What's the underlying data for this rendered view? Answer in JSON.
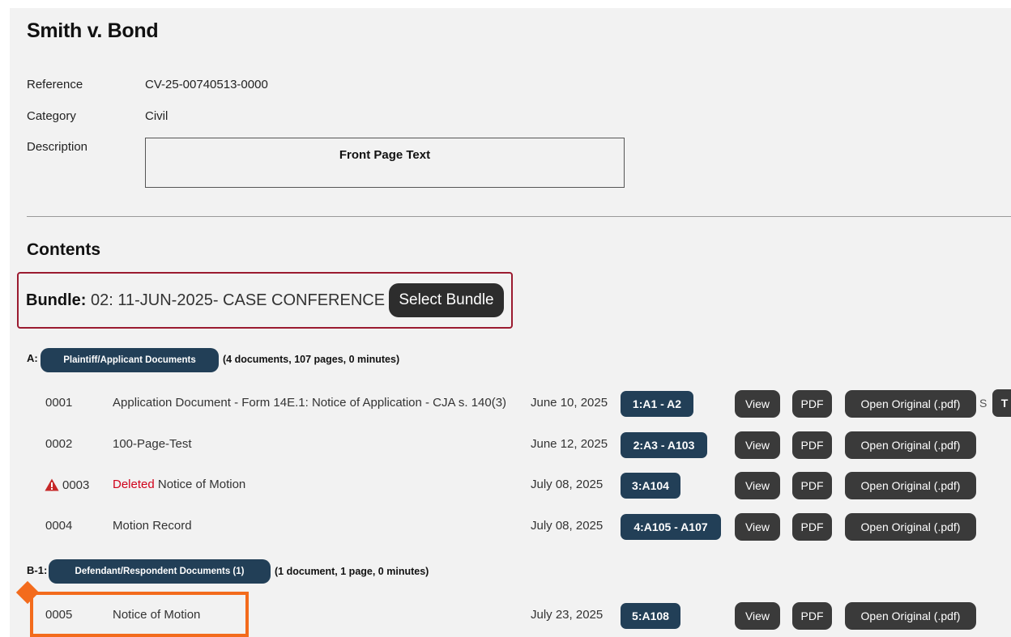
{
  "case": {
    "title": "Smith v. Bond",
    "reference_label": "Reference",
    "reference_value": "CV-25-00740513-0000",
    "category_label": "Category",
    "category_value": "Civil",
    "description_label": "Description",
    "description_value": "Front Page Text"
  },
  "contents": {
    "heading": "Contents",
    "bundle_label": "Bundle:",
    "bundle_value": "02: 11-JUN-2025- CASE CONFERENCE",
    "select_bundle": "Select Bundle"
  },
  "sections": [
    {
      "prefix": "A:",
      "name": "Plaintiff/Applicant Documents",
      "summary": "(4 documents, 107 pages, 0 minutes)"
    },
    {
      "prefix": "B-1:",
      "name": "Defendant/Respondent Documents (1)",
      "summary": "(1 document, 1 page, 0 minutes)"
    }
  ],
  "documents": [
    {
      "num": "0001",
      "deleted": "",
      "title": "Application Document - Form 14E.1: Notice of Application - CJA s. 140(3)",
      "date": "June 10, 2025",
      "pages": "1:A1 - A2",
      "view": "View",
      "pdf": "PDF",
      "original": "Open Original (.pdf)"
    },
    {
      "num": "0002",
      "deleted": "",
      "title": "100-Page-Test",
      "date": "June 12, 2025",
      "pages": "2:A3 - A103",
      "view": "View",
      "pdf": "PDF",
      "original": "Open Original (.pdf)"
    },
    {
      "num": "0003",
      "deleted": "Deleted",
      "title": "Notice of Motion",
      "date": "July 08, 2025",
      "pages": "3:A104",
      "view": "View",
      "pdf": "PDF",
      "original": "Open Original (.pdf)"
    },
    {
      "num": "0004",
      "deleted": "",
      "title": "Motion Record",
      "date": "July 08, 2025",
      "pages": "4:A105 - A107",
      "view": "View",
      "pdf": "PDF",
      "original": "Open Original (.pdf)"
    },
    {
      "num": "0005",
      "deleted": "",
      "title": "Notice of Motion",
      "date": "July 23, 2025",
      "pages": "5:A108",
      "view": "View",
      "pdf": "PDF",
      "original": "Open Original (.pdf)"
    }
  ],
  "row_extras": {
    "s_fragment": "S",
    "t_button": "T"
  },
  "colors": {
    "pill": "#223f57",
    "button": "#3a3a3a",
    "bundle_border": "#9b1b30",
    "deleted_text": "#d0021b",
    "highlight": "#f36b1c"
  },
  "icons": {
    "warning": "warning-triangle-icon"
  }
}
